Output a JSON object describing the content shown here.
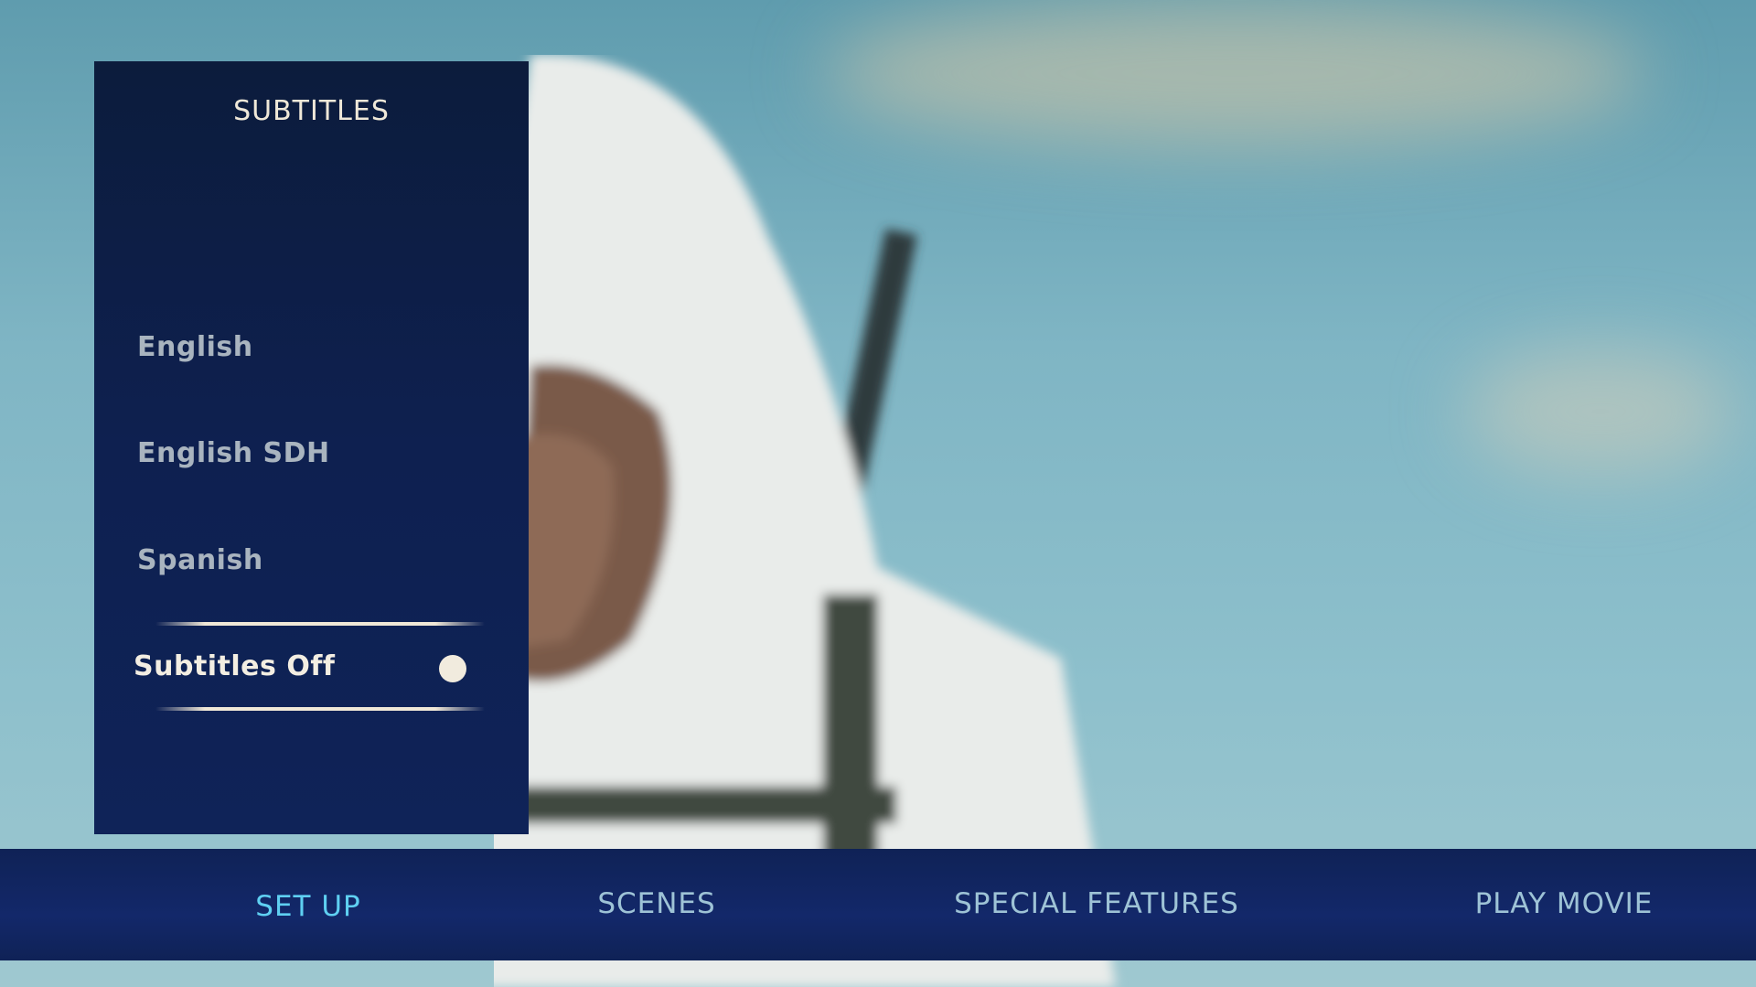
{
  "subtitles_menu": {
    "title": "SUBTITLES",
    "items": [
      {
        "label": "English",
        "selected": false
      },
      {
        "label": "English SDH",
        "selected": false
      },
      {
        "label": "Spanish",
        "selected": false
      },
      {
        "label": "Subtitles Off",
        "selected": true
      }
    ],
    "selected_indicator_icon": "filled-circle-icon"
  },
  "nav": {
    "items": [
      {
        "label": "SET UP",
        "active": true
      },
      {
        "label": "SCENES",
        "active": false
      },
      {
        "label": "SPECIAL FEATURES",
        "active": false
      },
      {
        "label": "PLAY MOVIE",
        "active": false
      }
    ]
  },
  "colors": {
    "panel": "#0e2050",
    "navbar": "#13286a",
    "active_nav": "#5fd0f2",
    "nav_text": "#9ec3d6"
  }
}
